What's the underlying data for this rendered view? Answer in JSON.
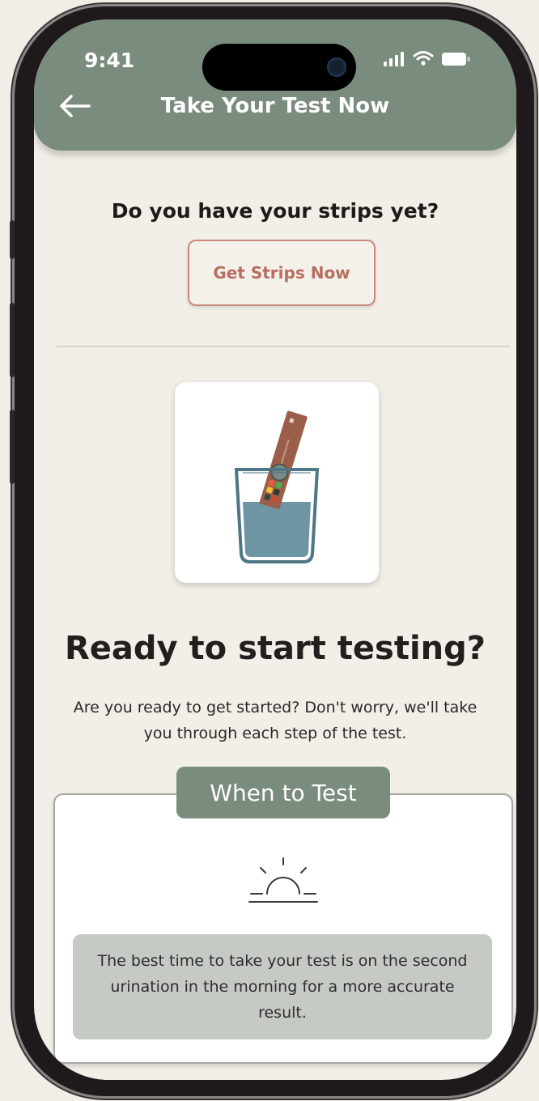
{
  "status_bar": {
    "time": "9:41"
  },
  "header": {
    "title": "Take Your Test Now"
  },
  "strips": {
    "question": "Do you have your strips yet?",
    "button_label": "Get Strips Now"
  },
  "intro": {
    "title": "Ready to start testing?",
    "description": "Are you ready to get started? Don't worry, we'll take you through each step of the test."
  },
  "when_to_test": {
    "tab_label": "When to Test",
    "icon": "sunrise-icon",
    "tip": "The best time to take your test is on the second urination in the morning for a more accurate result."
  },
  "colors": {
    "header": "#7a8c7d",
    "accent_border": "#c98a7a",
    "background": "#f2efe8"
  }
}
